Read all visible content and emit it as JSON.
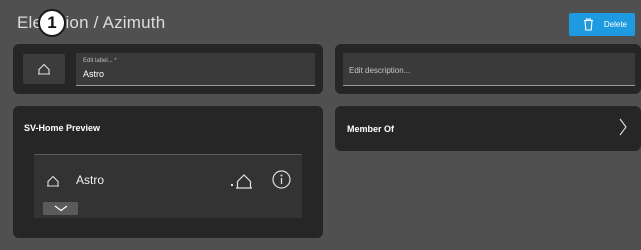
{
  "header": {
    "title": "Elevation / Azimuth",
    "step_badge": "1",
    "delete_label": "Delete"
  },
  "label_panel": {
    "field_label": "Edit label... *",
    "field_value": "Astro"
  },
  "description_panel": {
    "placeholder": "Edit description..."
  },
  "preview_panel": {
    "title": "SV-Home Preview",
    "item_name": "Astro"
  },
  "member_panel": {
    "title": "Member Of"
  },
  "icons": {
    "delete": "trash-icon",
    "home": "home-icon",
    "info": "info-icon",
    "expand": "chevron-down-icon",
    "navigate": "chevron-right-icon"
  },
  "colors": {
    "accent": "#1e9be0",
    "background": "#505050",
    "panel": "#262626"
  }
}
